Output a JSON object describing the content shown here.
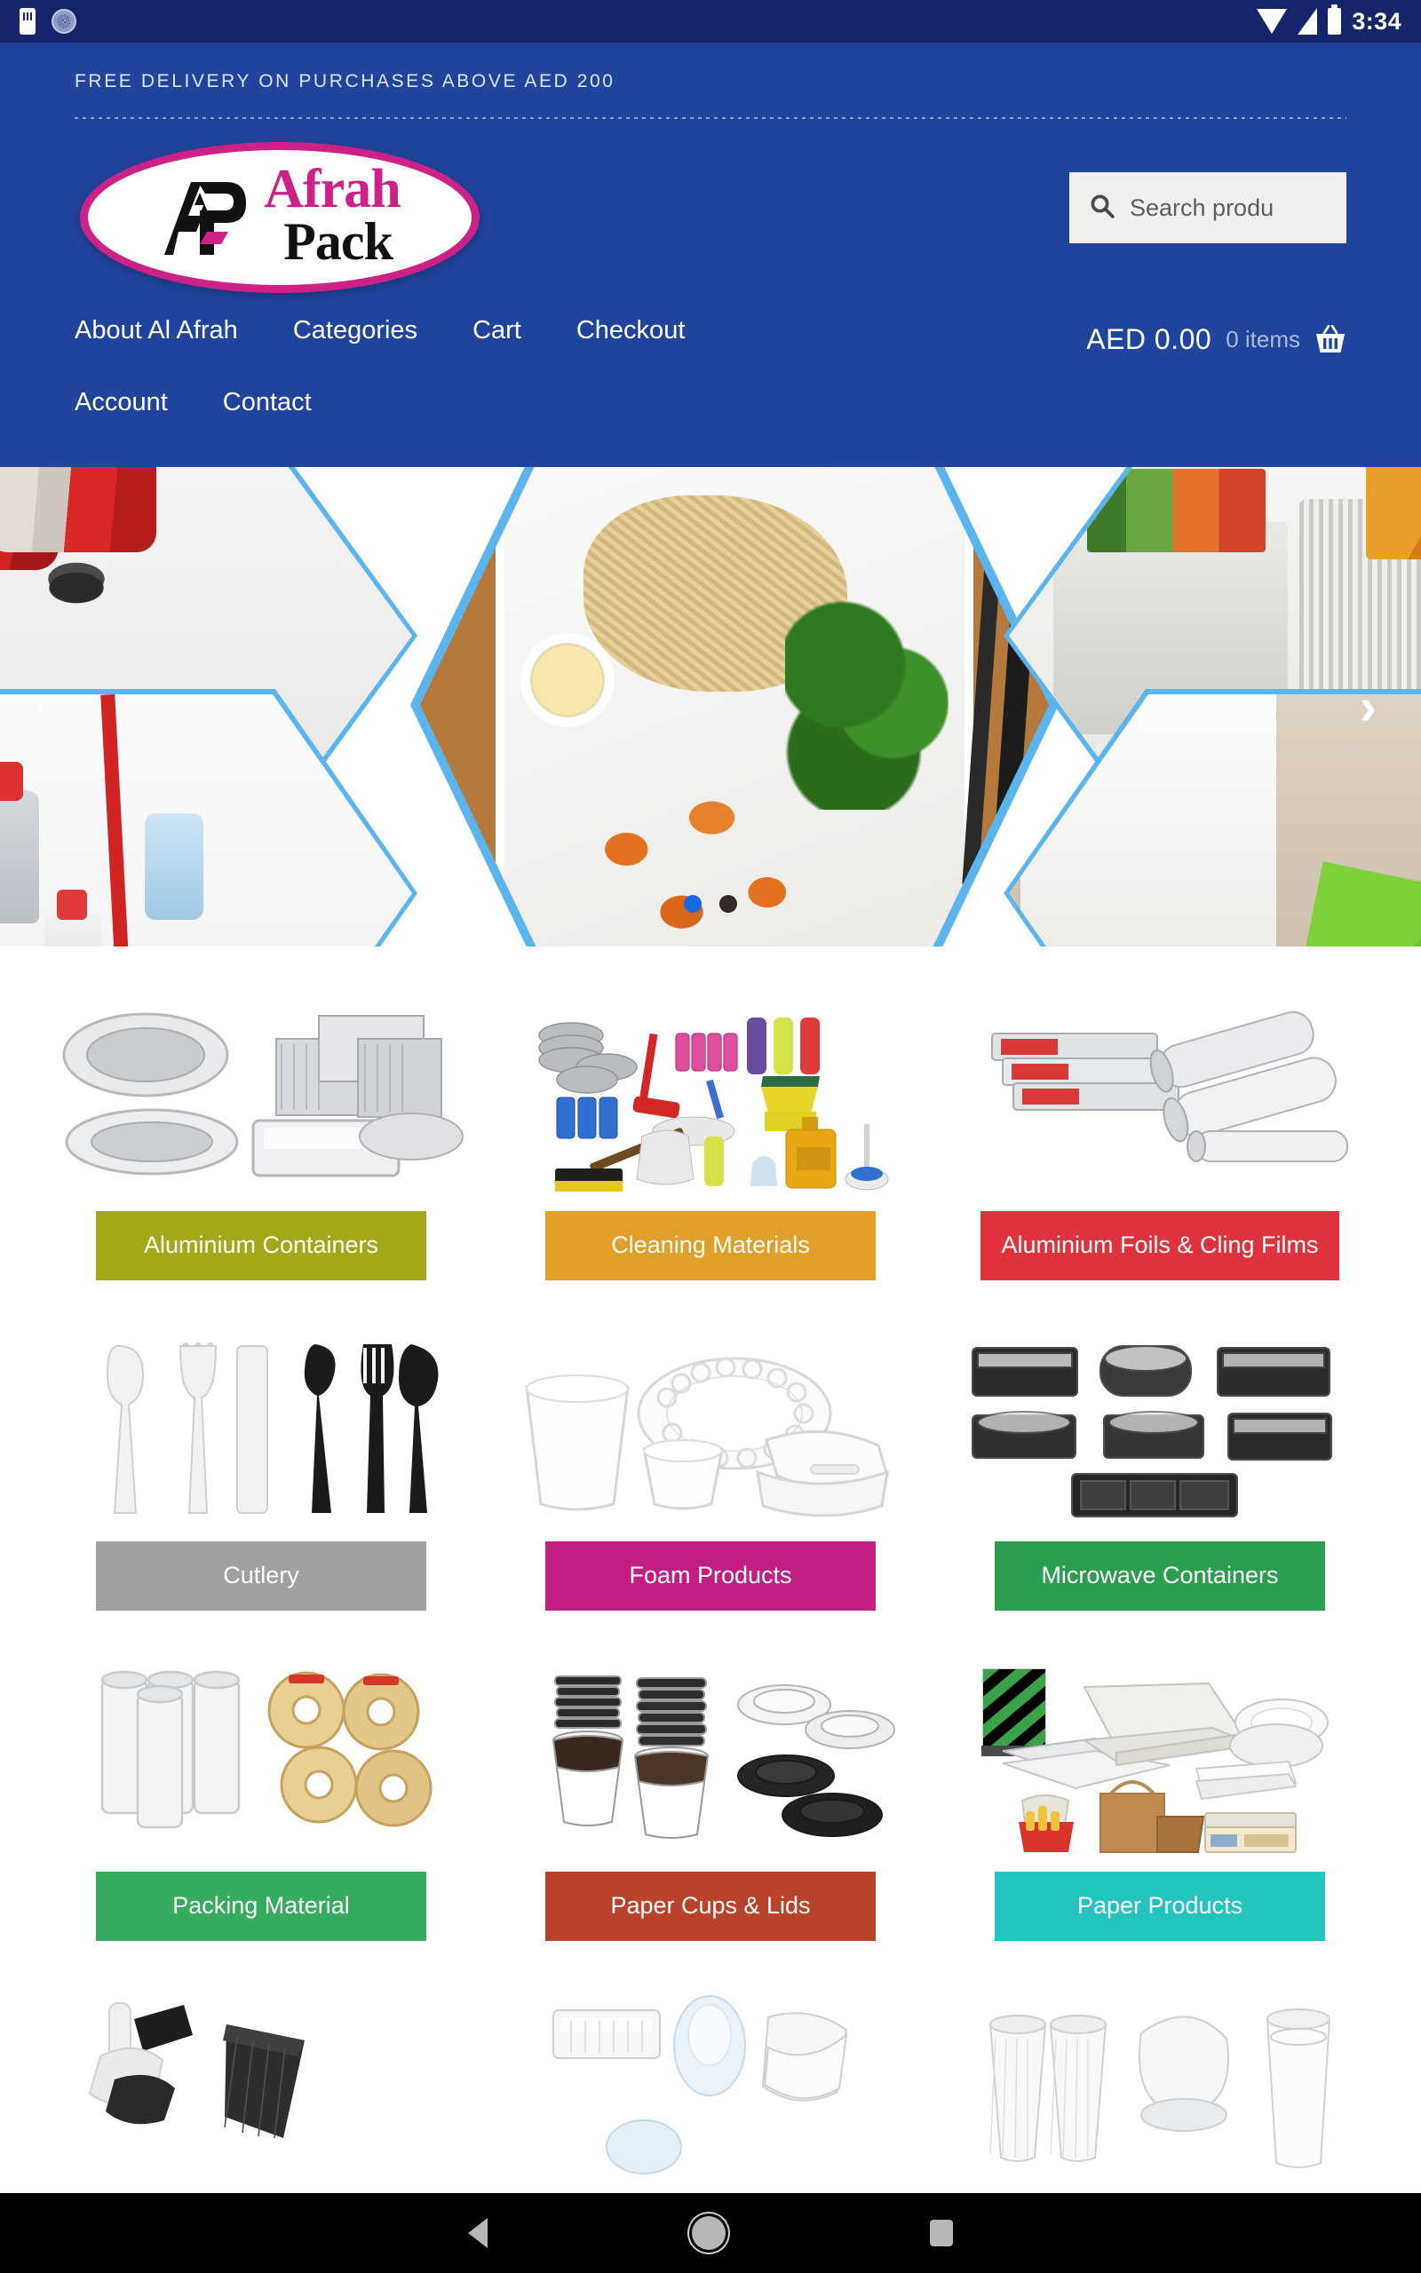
{
  "status_bar": {
    "time": "3:34",
    "icons": [
      "sim-card-icon",
      "clock-face-icon",
      "wifi-icon",
      "signal-icon",
      "battery-icon"
    ]
  },
  "header": {
    "promo_text": "FREE DELIVERY ON PURCHASES ABOVE AED 200",
    "logo": {
      "monogram": "AP",
      "word_one": "Afrah",
      "word_two": "Pack",
      "word_one_color": "#cc2288",
      "word_two_color": "#111111",
      "ring_color": "#cc2288"
    },
    "search": {
      "placeholder": "Search produ",
      "value": "",
      "icon": "search-icon"
    },
    "nav_items": [
      {
        "label": "About Al Afrah"
      },
      {
        "label": "Categories"
      },
      {
        "label": "Cart"
      },
      {
        "label": "Checkout"
      },
      {
        "label": "Account"
      },
      {
        "label": "Contact"
      }
    ],
    "cart": {
      "total": "AED 0.00",
      "items": "0 items",
      "icon": "shopping-basket-icon"
    },
    "background_color": "#20449c"
  },
  "carousel": {
    "prev_label": "‹",
    "next_label": "›",
    "slide_count": 2,
    "active_slide": 1,
    "active_dot_color": "#1769e0",
    "inactive_dot_color": "#332b26",
    "hex_border_color": "#5ab4ee",
    "tiles": [
      "paper-cups-and-lids-photo",
      "takeaway-meal-container-photo",
      "aluminium-foil-trays-photo",
      "cleaning-supplies-photo",
      "cling-film-wrapping-photo"
    ]
  },
  "categories": [
    {
      "label": "Aluminium Containers",
      "color": "#a3a817",
      "image": "aluminium-containers-image",
      "two_line": false
    },
    {
      "label": "Cleaning Materials",
      "color": "#e0a028",
      "image": "cleaning-materials-image",
      "two_line": false
    },
    {
      "label": "Aluminium Foils & Cling Films",
      "color": "#e0323c",
      "image": "aluminium-foils-cling-films-image",
      "two_line": true
    },
    {
      "label": "Cutlery",
      "color": "#a0a0a0",
      "image": "cutlery-image",
      "two_line": false
    },
    {
      "label": "Foam Products",
      "color": "#c41d84",
      "image": "foam-products-image",
      "two_line": false
    },
    {
      "label": "Microwave Containers",
      "color": "#2a9d4e",
      "image": "microwave-containers-image",
      "two_line": false
    },
    {
      "label": "Packing Material",
      "color": "#35ab60",
      "image": "packing-material-image",
      "two_line": false
    },
    {
      "label": "Paper Cups & Lids",
      "color": "#b9432a",
      "image": "paper-cups-lids-image",
      "two_line": false
    },
    {
      "label": "Paper Products",
      "color": "#23c4bd",
      "image": "paper-products-image",
      "two_line": false
    }
  ],
  "partial_row": [
    {
      "image": "garbage-bags-image"
    },
    {
      "image": "plastic-containers-image"
    },
    {
      "image": "plastic-cups-image"
    }
  ],
  "android_nav": {
    "back": "back-button",
    "home": "home-button",
    "recents": "recents-button"
  }
}
